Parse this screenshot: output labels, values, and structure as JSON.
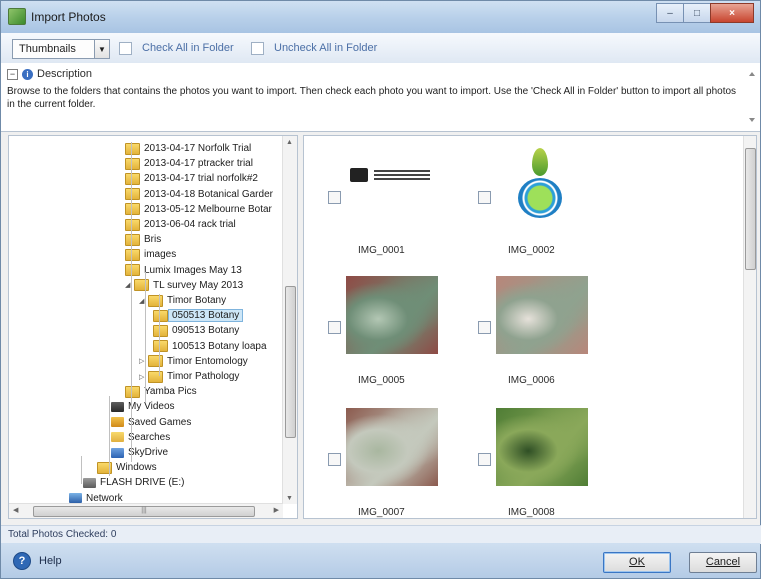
{
  "window": {
    "title": "Import Photos"
  },
  "toolbar": {
    "view_mode": "Thumbnails",
    "check_all": "Check All in Folder",
    "uncheck_all": "Uncheck All in Folder"
  },
  "description": {
    "header": "Description",
    "text": "Browse to the folders that contains the photos you want to import. Then check each photo you want to import. Use the 'Check All in Folder' button to import all photos in the current folder."
  },
  "tree": {
    "items": [
      {
        "label": "2013-04-17 Norfolk Trial",
        "depth": 2,
        "icon": "folder-icon"
      },
      {
        "label": "2013-04-17 ptracker trial",
        "depth": 2,
        "icon": "folder-icon"
      },
      {
        "label": "2013-04-17 trial norfolk#2",
        "depth": 2,
        "icon": "folder-icon"
      },
      {
        "label": "2013-04-18 Botanical Garder",
        "depth": 2,
        "icon": "folder-icon"
      },
      {
        "label": "2013-05-12 Melbourne Botar",
        "depth": 2,
        "icon": "folder-icon"
      },
      {
        "label": "2013-06-04 rack trial",
        "depth": 2,
        "icon": "folder-icon"
      },
      {
        "label": "Bris",
        "depth": 2,
        "icon": "folder-icon"
      },
      {
        "label": "images",
        "depth": 2,
        "icon": "folder-icon"
      },
      {
        "label": "Lumix Images May 13",
        "depth": 2,
        "icon": "folder-icon"
      },
      {
        "label": "TL survey May 2013",
        "depth": 2,
        "icon": "folder-icon"
      },
      {
        "label": "Timor Botany",
        "depth": 3,
        "icon": "folder-icon"
      },
      {
        "label": "050513 Botany",
        "depth": 4,
        "icon": "folder-icon",
        "selected": true
      },
      {
        "label": "090513 Botany",
        "depth": 4,
        "icon": "folder-icon"
      },
      {
        "label": "100513 Botany loapa",
        "depth": 4,
        "icon": "folder-icon"
      },
      {
        "label": "Timor Entomology",
        "depth": 3,
        "icon": "folder-icon"
      },
      {
        "label": "Timor Pathology",
        "depth": 3,
        "icon": "folder-icon"
      },
      {
        "label": "Yamba Pics",
        "depth": 2,
        "icon": "folder-icon"
      },
      {
        "label": "My Videos",
        "depth": 1,
        "icon": "videos-icon"
      },
      {
        "label": "Saved Games",
        "depth": 1,
        "icon": "games-icon"
      },
      {
        "label": "Searches",
        "depth": 1,
        "icon": "search-folder-icon"
      },
      {
        "label": "SkyDrive",
        "depth": 1,
        "icon": "cloud-icon"
      },
      {
        "label": "Windows",
        "depth": 0,
        "icon": "folder-icon"
      },
      {
        "label": "FLASH DRIVE (E:)",
        "depth": -1,
        "icon": "drive-icon"
      },
      {
        "label": "Network",
        "depth": -2,
        "icon": "network-icon"
      }
    ]
  },
  "photos": [
    {
      "label": "IMG_0001",
      "kind": "logo-gov",
      "colors": [
        "#ffffff"
      ]
    },
    {
      "label": "IMG_0002",
      "kind": "logo-leaf",
      "colors": [
        "#ffffff"
      ]
    },
    {
      "label": "IMG_0005",
      "kind": "plant",
      "colors": [
        "#8f4a45",
        "#6f8e77",
        "#b3c7b4"
      ]
    },
    {
      "label": "IMG_0006",
      "kind": "plant",
      "colors": [
        "#b8867a",
        "#8fa28f",
        "#e6e1da"
      ]
    },
    {
      "label": "IMG_0007",
      "kind": "plant",
      "colors": [
        "#8b5a4e",
        "#c4c9bd",
        "#a9b7a0"
      ]
    },
    {
      "label": "IMG_0008",
      "kind": "plant",
      "colors": [
        "#4f7d35",
        "#8aa85a",
        "#2f4f25"
      ]
    }
  ],
  "status": {
    "text": "Total Photos Checked: 0"
  },
  "buttons": {
    "help": "Help",
    "ok": "OK",
    "cancel": "Cancel"
  },
  "colors": {
    "accent": "#3a6fc1",
    "selection": "#cde6f7"
  }
}
